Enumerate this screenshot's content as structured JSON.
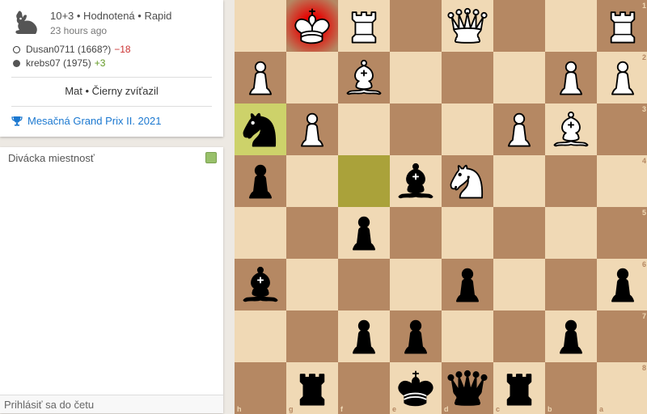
{
  "game": {
    "meta": "10+3 • Hodnotená • Rapid",
    "time_ago": "23 hours ago",
    "white_player": {
      "name": "Dusan0711 (1668?)",
      "delta": "−18"
    },
    "black_player": {
      "name": "krebs07 (1975)",
      "delta": "+3"
    },
    "result": "Mat • Čierny zvíťazil",
    "tournament": "Mesačná Grand Prix II. 2021"
  },
  "chat": {
    "title": "Divácka miestnosť",
    "input_placeholder": "Prihlásiť sa do četu"
  },
  "board": {
    "orientation": "black",
    "rank_labels": [
      "1",
      "2",
      "3",
      "4",
      "5",
      "6",
      "7",
      "8"
    ],
    "file_labels": [
      "h",
      "g",
      "f",
      "e",
      "d",
      "c",
      "b",
      "a"
    ],
    "rows": [
      [
        "",
        "wK",
        "wR",
        "",
        "wQ",
        "",
        "",
        "wR"
      ],
      [
        "wP",
        "",
        "wB",
        "",
        "",
        "",
        "wP",
        "wP"
      ],
      [
        "bN",
        "wP",
        "",
        "",
        "",
        "wP",
        "wB",
        ""
      ],
      [
        "bP",
        "",
        "",
        "bB",
        "wN",
        "",
        "",
        ""
      ],
      [
        "",
        "",
        "bP",
        "",
        "",
        "",
        "",
        ""
      ],
      [
        "bB",
        "",
        "",
        "",
        "bP",
        "",
        "",
        "bP"
      ],
      [
        "",
        "",
        "bP",
        "bP",
        "",
        "",
        "bP",
        ""
      ],
      [
        "",
        "bR",
        "",
        "bK",
        "bQ",
        "bR",
        "",
        ""
      ]
    ],
    "last_move": [
      "f4",
      "h3"
    ],
    "check_square": "g1"
  }
}
